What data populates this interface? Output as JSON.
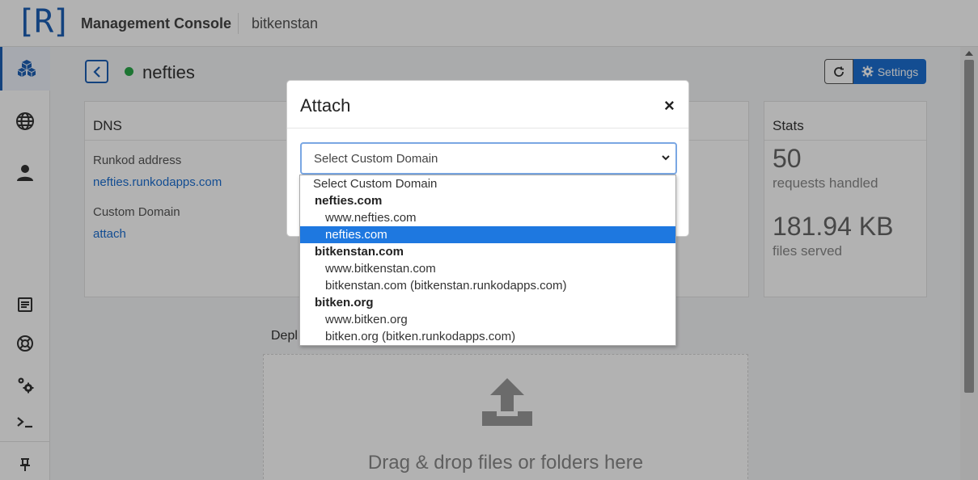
{
  "header": {
    "logo": "[R]",
    "console_title": "Management Console",
    "org_name": "bitkenstan"
  },
  "sidebar": {
    "items": [
      {
        "icon": "cubes-icon",
        "active": true
      },
      {
        "icon": "globe-icon"
      },
      {
        "icon": "user-icon"
      },
      {
        "icon": "document-icon"
      },
      {
        "icon": "support-icon"
      },
      {
        "icon": "gears-icon"
      },
      {
        "icon": "terminal-icon"
      },
      {
        "icon": "pin-icon"
      }
    ]
  },
  "page": {
    "site_name": "nefties",
    "status": "online",
    "settings_label": "Settings"
  },
  "dns": {
    "title": "DNS",
    "runkod_label": "Runkod address",
    "runkod_value": "nefties.runkodapps.com",
    "custom_domain_label": "Custom Domain",
    "custom_domain_value": "attach"
  },
  "stats": {
    "title": "Stats",
    "requests_value": "50",
    "requests_label": "requests handled",
    "files_value": "181.94 KB",
    "files_label": "files served"
  },
  "deploy": {
    "title": "Depl",
    "drop_text": "Drag & drop files or folders here"
  },
  "modal": {
    "title": "Attach",
    "close": "×",
    "select_value": "Select Custom Domain",
    "options": [
      {
        "type": "placeholder",
        "label": "Select Custom Domain"
      },
      {
        "type": "group",
        "label": "nefties.com"
      },
      {
        "type": "item",
        "label": "www.nefties.com"
      },
      {
        "type": "item",
        "label": "nefties.com",
        "selected": true
      },
      {
        "type": "group",
        "label": "bitkenstan.com"
      },
      {
        "type": "item",
        "label": "www.bitkenstan.com"
      },
      {
        "type": "item",
        "label": "bitkenstan.com (bitkenstan.runkodapps.com)"
      },
      {
        "type": "group",
        "label": "bitken.org"
      },
      {
        "type": "item",
        "label": "www.bitken.org"
      },
      {
        "type": "item",
        "label": "bitken.org (bitken.runkodapps.com)"
      }
    ]
  },
  "colors": {
    "accent": "#1c6fd1",
    "status_online": "#2aa84a",
    "selected_option": "#1e78e0"
  }
}
